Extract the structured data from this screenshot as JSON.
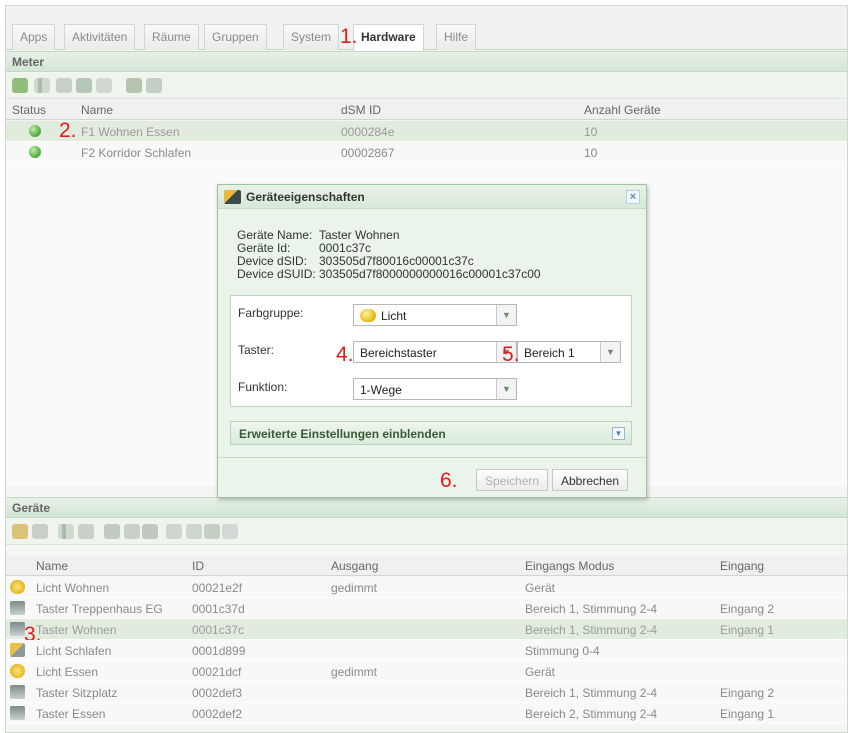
{
  "tabs": [
    "Apps",
    "Aktivitäten",
    "Räume",
    "Gruppen",
    "System",
    "Hardware",
    "Hilfe"
  ],
  "active_tab": "Hardware",
  "markers": [
    "1.",
    "2.",
    "3.",
    "4.",
    "5.",
    "6."
  ],
  "meter": {
    "title": "Meter",
    "columns": {
      "status": "Status",
      "name": "Name",
      "dsm_id": "dSM ID",
      "count": "Anzahl Geräte"
    },
    "rows": [
      {
        "name": "F1 Wohnen Essen",
        "dsm_id": "0000284e",
        "count": "10"
      },
      {
        "name": "F2 Korridor Schlafen",
        "dsm_id": "00002867",
        "count": "10"
      }
    ]
  },
  "dialog": {
    "title": "Geräteeigenschaften",
    "close": "×",
    "info": [
      {
        "k": "Geräte Name:",
        "v": "Taster Wohnen"
      },
      {
        "k": "Geräte Id:",
        "v": "0001c37c"
      },
      {
        "k": "Device dSID:",
        "v": "303505d7f80016c00001c37c"
      },
      {
        "k": "Device dSUID:",
        "v": "303505d7f8000000000016c00001c37c00"
      }
    ],
    "farbgruppe_label": "Farbgruppe:",
    "farbgruppe_value": "Licht",
    "taster_label": "Taster:",
    "taster_value": "Bereichstaster",
    "bereich_value": "Bereich 1",
    "funktion_label": "Funktion:",
    "funktion_value": "1-Wege",
    "advanced": "Erweiterte Einstellungen einblenden",
    "save": "Speichern",
    "cancel": "Abbrechen"
  },
  "geraete": {
    "title": "Geräte",
    "columns": {
      "name": "Name",
      "id": "ID",
      "ausgang": "Ausgang",
      "modus": "Eingangs Modus",
      "eingang": "Eingang"
    },
    "rows": [
      {
        "name": "Licht Wohnen",
        "id": "00021e2f",
        "ausgang": "gedimmt",
        "modus": "Gerät",
        "eingang": "",
        "icon": "light"
      },
      {
        "name": "Taster Treppenhaus EG",
        "id": "0001c37d",
        "ausgang": "",
        "modus": "Bereich 1, Stimmung 2-4",
        "eingang": "Eingang 2",
        "icon": "switch"
      },
      {
        "name": "Taster Wohnen",
        "id": "0001c37c",
        "ausgang": "",
        "modus": "Bereich 1, Stimmung 2-4",
        "eingang": "Eingang 1",
        "icon": "switch"
      },
      {
        "name": "Licht Schlafen",
        "id": "0001d899",
        "ausgang": "",
        "modus": "Stimmung 0-4",
        "eingang": "",
        "icon": "light-switch"
      },
      {
        "name": "Licht Essen",
        "id": "00021dcf",
        "ausgang": "gedimmt",
        "modus": "Gerät",
        "eingang": "",
        "icon": "light"
      },
      {
        "name": "Taster Sitzplatz",
        "id": "0002def3",
        "ausgang": "",
        "modus": "Bereich 1, Stimmung 2-4",
        "eingang": "Eingang 2",
        "icon": "switch"
      },
      {
        "name": "Taster Essen",
        "id": "0002def2",
        "ausgang": "",
        "modus": "Bereich 2, Stimmung 2-4",
        "eingang": "Eingang 1",
        "icon": "switch"
      }
    ]
  }
}
